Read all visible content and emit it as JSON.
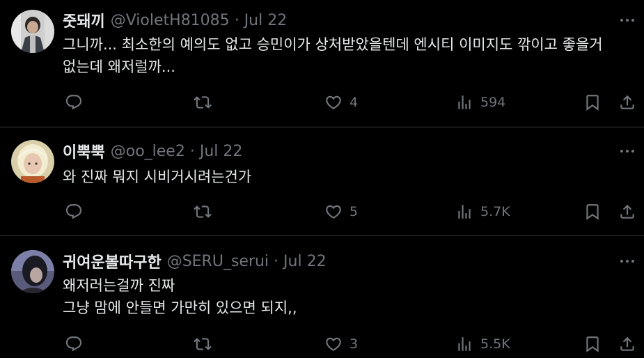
{
  "tweets": [
    {
      "name": "줏돼끼",
      "handle": "@VioletH81085",
      "separator": "·",
      "date": "Jul 22",
      "lines": [
        "그니까... 최소한의 예의도 없고 승민이가 상처받았을텐데 엔시티 이미지도 깎이고 좋을거",
        "없는데 왜저럴까..."
      ],
      "likes": "4",
      "views": "594"
    },
    {
      "name": "이뿍뿍",
      "handle": "@oo_lee2",
      "separator": "·",
      "date": "Jul 22",
      "lines": [
        "와 진짜 뭐지 시비거시려는건가"
      ],
      "likes": "5",
      "views": "5.7K"
    },
    {
      "name": "귀여운볼따구한",
      "handle": "@SERU_serui",
      "separator": "·",
      "date": "Jul 22",
      "lines": [
        "왜저러는걸까 진짜",
        "그냥 맘에 안들면 가만히 있으면 되지,,"
      ],
      "likes": "3",
      "views": "5.5K"
    }
  ],
  "icons": {
    "reply": "reply-icon",
    "retweet": "retweet-icon",
    "like": "heart-icon",
    "views": "views-icon",
    "bookmark": "bookmark-icon",
    "share": "share-icon",
    "more": "more-icon"
  },
  "colors": {
    "background": "#000000",
    "text": "#e7e9ea",
    "muted": "#71767b",
    "divider": "#2f3336"
  }
}
